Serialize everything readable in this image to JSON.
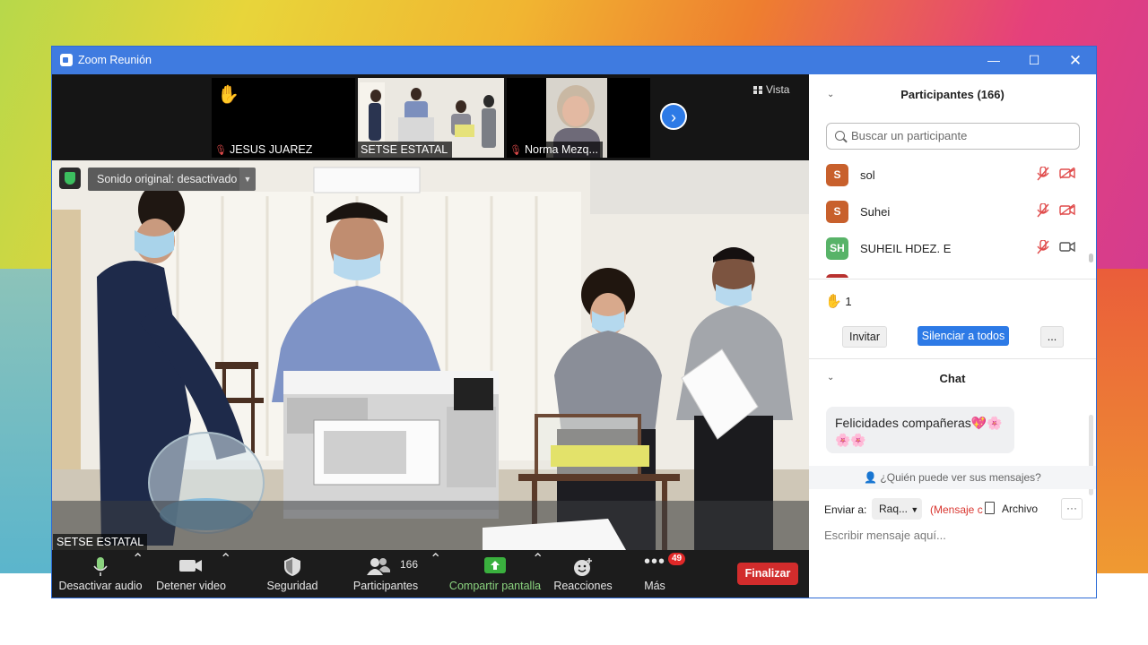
{
  "window": {
    "title": "Zoom Reunión",
    "accent": "#3f7be0"
  },
  "strip": {
    "thumbnails": [
      {
        "name": "JESUS JUAREZ",
        "muted": true
      },
      {
        "name": "SETSE ESTATAL",
        "muted": false
      },
      {
        "name": "Norma Mezq...",
        "muted": true
      }
    ],
    "view_label": "Vista"
  },
  "main": {
    "original_sound": "Sonido original: desactivado",
    "speaker_name": "SETSE ESTATAL"
  },
  "toolbar": {
    "mute": "Desactivar audio",
    "video": "Detener video",
    "security": "Seguridad",
    "participants": "Participantes",
    "participants_count": "166",
    "share": "Compartir pantalla",
    "reactions": "Reacciones",
    "more": "Más",
    "more_badge": "49",
    "end": "Finalizar"
  },
  "participants": {
    "header": "Participantes (166)",
    "search_placeholder": "Buscar un participante",
    "list": [
      {
        "initials": "S",
        "name": "sol",
        "color": "#c8602c"
      },
      {
        "initials": "S",
        "name": "Suhei",
        "color": "#c8602c"
      },
      {
        "initials": "SH",
        "name": "SUHEIL HDEZ. E",
        "color": "#58b368"
      }
    ],
    "hand_count": "1",
    "invite": "Invitar",
    "mute_all": "Silenciar a todos",
    "more": "..."
  },
  "chat": {
    "header": "Chat",
    "messages": [
      "Felicidades compañeras💖🌸🌸🌸"
    ],
    "who_can_see": "¿Quién puede ver sus mensajes?",
    "send_to_label": "Enviar a:",
    "recipient": "Raq...",
    "message_type": "(Mensaje c",
    "file": "Archivo",
    "more": "···",
    "input_placeholder": "Escribir mensaje aquí..."
  }
}
